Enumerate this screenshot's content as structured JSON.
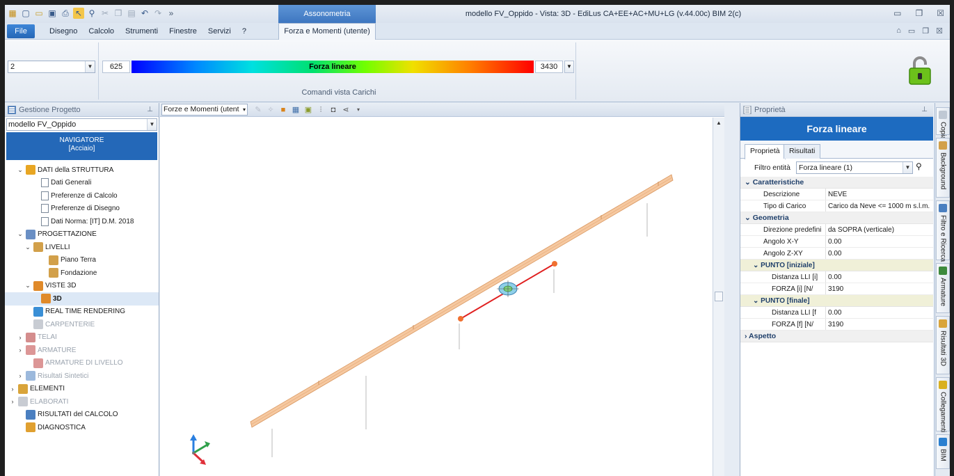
{
  "titlebar": {
    "context_tab": "Assonometria",
    "window_title": "modello FV_Oppido -  Vista: 3D - EdiLus CA+EE+AC+MU+LG (v.44.00c) BIM 2(c)"
  },
  "menubar": {
    "file": "File",
    "items": [
      "Disegno",
      "Calcolo",
      "Strumenti",
      "Finestre",
      "Servizi",
      "?"
    ],
    "active_tab": "Forza e Momenti (utente)"
  },
  "ribbon": {
    "level_value": "2",
    "min_value": "625",
    "gradient_label": "Forza lineare",
    "max_value": "3430",
    "group_label": "Comandi vista Carichi"
  },
  "left_panel": {
    "title": "Gestione Progetto",
    "project": "modello FV_Oppido",
    "navigator_title": "NAVIGATORE",
    "navigator_sub": "[Acciaio]",
    "tree": [
      {
        "label": "DATI della STRUTTURA",
        "indent": 0,
        "exp": "v",
        "icon": "folder-data"
      },
      {
        "label": "Dati Generali",
        "indent": 2,
        "exp": "",
        "icon": "doc"
      },
      {
        "label": "Preferenze di Calcolo",
        "indent": 2,
        "exp": "",
        "icon": "doc"
      },
      {
        "label": "Preferenze di Disegno",
        "indent": 2,
        "exp": "",
        "icon": "doc"
      },
      {
        "label": "Dati Norma: [IT] D.M. 2018",
        "indent": 2,
        "exp": "",
        "icon": "doc"
      },
      {
        "label": "PROGETTAZIONE",
        "indent": 0,
        "exp": "v",
        "icon": "design"
      },
      {
        "label": "LIVELLI",
        "indent": 1,
        "exp": "v",
        "icon": "levels"
      },
      {
        "label": "Piano Terra",
        "indent": 3,
        "exp": "",
        "icon": "level"
      },
      {
        "label": "Fondazione",
        "indent": 3,
        "exp": "",
        "icon": "level"
      },
      {
        "label": "VISTE 3D",
        "indent": 1,
        "exp": "v",
        "icon": "view3d"
      },
      {
        "label": "3D",
        "indent": 2,
        "exp": "",
        "icon": "view3d",
        "selected": true
      },
      {
        "label": "REAL TIME RENDERING",
        "indent": 1,
        "exp": "",
        "icon": "render"
      },
      {
        "label": "CARPENTERIE",
        "indent": 1,
        "exp": "",
        "icon": "carp",
        "dim": true
      },
      {
        "label": "TELAI",
        "indent": 0,
        "exp": ">",
        "icon": "frame",
        "dim": true
      },
      {
        "label": "ARMATURE",
        "indent": 0,
        "exp": ">",
        "icon": "rebar",
        "dim": true
      },
      {
        "label": "ARMATURE DI LIVELLO",
        "indent": 1,
        "exp": "",
        "icon": "rebar2",
        "dim": true
      },
      {
        "label": "Risultati Sintetici",
        "indent": 0,
        "exp": ">",
        "icon": "results",
        "dim": true
      },
      {
        "label": "ELEMENTI",
        "indent": -1,
        "exp": ">",
        "icon": "elements"
      },
      {
        "label": "ELABORATI",
        "indent": -1,
        "exp": ">",
        "icon": "drawings",
        "dim": true
      },
      {
        "label": "RISULTATI del CALCOLO",
        "indent": 0,
        "exp": "",
        "icon": "calc"
      },
      {
        "label": "DIAGNOSTICA",
        "indent": 0,
        "exp": "",
        "icon": "diag"
      }
    ]
  },
  "viewport": {
    "combo": "Forze e Momenti (utent"
  },
  "properties": {
    "panel_title": "Proprietà",
    "header": "Forza lineare",
    "tabs": [
      "Proprietà",
      "Risultati"
    ],
    "filter_label": "Filtro entità",
    "filter_value": "Forza lineare (1)",
    "sections": {
      "caratteristiche": "Caratteristiche",
      "geometria": "Geometria",
      "punto_iniziale": "PUNTO [iniziale]",
      "punto_finale": "PUNTO [finale]",
      "aspetto": "Aspetto"
    },
    "rows": {
      "descrizione_k": "Descrizione",
      "descrizione_v": "NEVE",
      "tipo_k": "Tipo di Carico",
      "tipo_v": "Carico da Neve <= 1000 m s.l.m.",
      "direzione_k": "Direzione predefini",
      "direzione_v": "da SOPRA (verticale)",
      "angxy_k": "Angolo X-Y",
      "angxy_v": "0.00",
      "angzxy_k": "Angolo Z-XY",
      "angzxy_v": "0.00",
      "dist_i_k": "Distanza LLI [i]",
      "dist_i_v": "0.00",
      "forza_i_k": "FORZA [i] [N/",
      "forza_i_v": "3190",
      "dist_f_k": "Distanza LLI [f",
      "dist_f_v": "0.00",
      "forza_f_k": "FORZA [f] [N/",
      "forza_f_v": "3190"
    }
  },
  "side_tabs": [
    "Copia",
    "Background",
    "Filtro e Ricerca",
    "Armature",
    "Risultati 3D",
    "Collegamenti",
    "BIM"
  ],
  "colors": {
    "accent": "#1d6bc0",
    "beam": "#f5c8a0",
    "highlight": "#e02020"
  }
}
